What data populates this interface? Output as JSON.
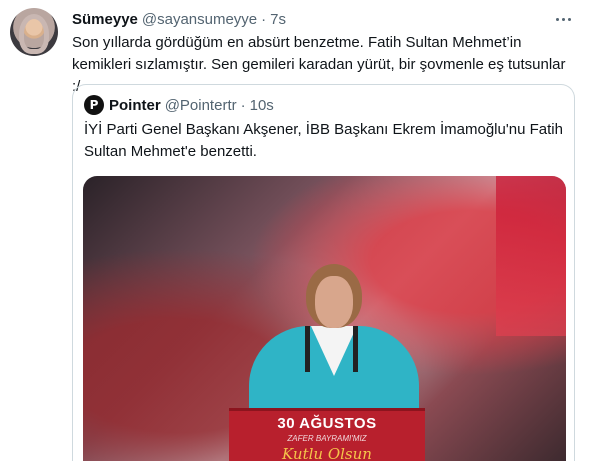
{
  "tweet": {
    "author_name": "Sümeyye",
    "author_handle": "@sayansumeyye",
    "separator": "·",
    "time": "7s",
    "text": "Son yıllarda gördüğüm en absürt benzetme. Fatih Sultan Mehmet’in kemikleri sızlamıştır. Sen gemileri karadan yürüt, bir şovmenle eş tutsunlar :/"
  },
  "quoted_tweet": {
    "author_name": "Pointer",
    "author_handle": "@Pointertr",
    "separator": "·",
    "time": "10s",
    "logo_letter": "P",
    "text": "İYİ Parti Genel Başkanı Akşener, İBB Başkanı Ekrem İmamoğlu'nu Fatih Sultan Mehmet'e benzetti.",
    "media": {
      "podium_line1": "30 AĞUSTOS",
      "podium_line2": "ZAFER BAYRAMI'MIZ",
      "podium_line3": "Kutlu Olsun"
    }
  },
  "colors": {
    "text": "#0f1419",
    "secondary": "#536471",
    "border": "#cfd9de",
    "jacket": "#2fb4c6",
    "podium": "#b8202d"
  }
}
